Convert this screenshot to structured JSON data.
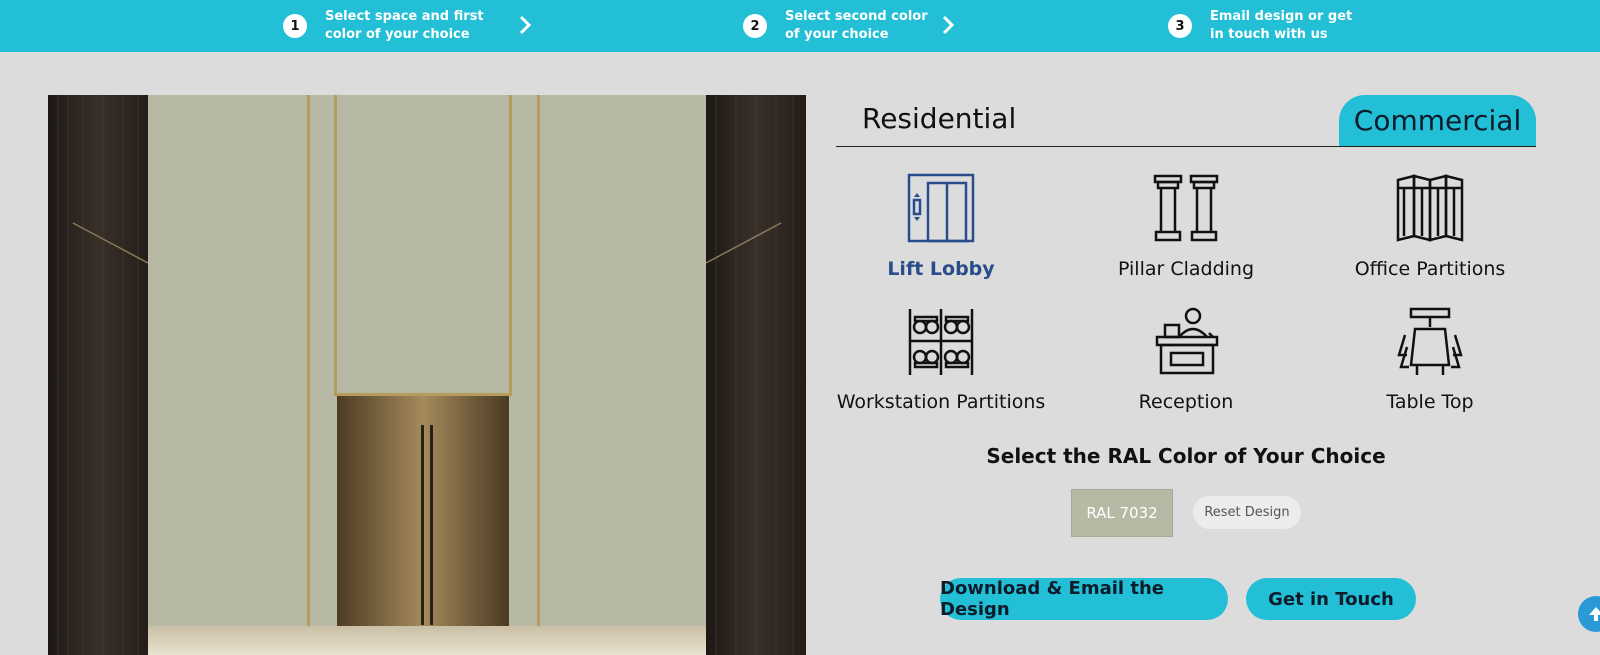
{
  "steps": [
    {
      "number": "1",
      "line1": "Select space and first",
      "line2": "color of your choice"
    },
    {
      "number": "2",
      "line1": "Select second color",
      "line2": "of your choice"
    },
    {
      "number": "3",
      "line1": "Email design or get",
      "line2": "in touch with us"
    }
  ],
  "tabs": {
    "residential": "Residential",
    "commercial": "Commercial",
    "active": "commercial"
  },
  "spaces": [
    {
      "label": "Lift Lobby",
      "icon": "elevator-icon",
      "active": true
    },
    {
      "label": "Pillar Cladding",
      "icon": "pillars-icon",
      "active": false
    },
    {
      "label": "Office Partitions",
      "icon": "folding-screen-icon",
      "active": false
    },
    {
      "label": "Workstation Partitions",
      "icon": "workstation-icon",
      "active": false
    },
    {
      "label": "Reception",
      "icon": "reception-desk-icon",
      "active": false
    },
    {
      "label": "Table Top",
      "icon": "conference-table-icon",
      "active": false
    }
  ],
  "ral": {
    "heading": "Select the RAL Color of Your Choice",
    "selected_label": "RAL 7032",
    "selected_color": "#b7b9a5",
    "reset_label": "Reset Design"
  },
  "actions": {
    "download_label": "Download & Email the Design",
    "contact_label": "Get in Touch"
  },
  "colors": {
    "accent": "#22bfd6",
    "active_text": "#294d8a",
    "background": "#dcdcdc"
  }
}
